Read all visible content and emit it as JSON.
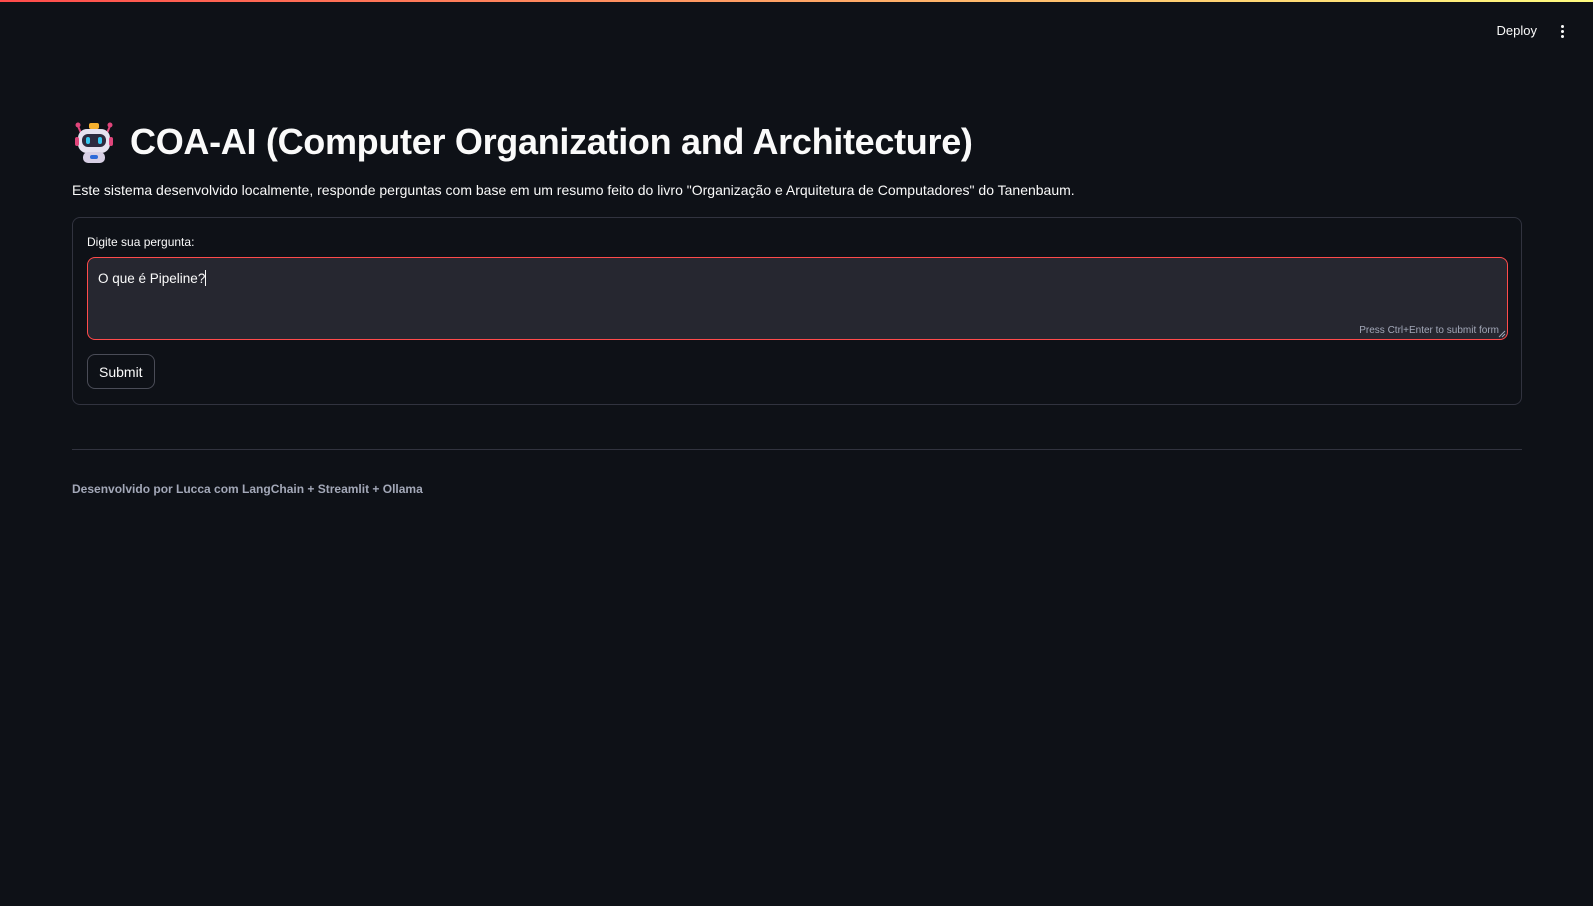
{
  "header": {
    "deploy_label": "Deploy",
    "menu_icon": "kebab-menu-icon"
  },
  "main": {
    "title_icon": "robot-icon",
    "title": "COA-AI (Computer Organization and Architecture)",
    "description": "Este sistema desenvolvido localmente, responde perguntas com base em um resumo feito do livro \"Organização e Arquitetura de Computadores\" do Tanenbaum."
  },
  "form": {
    "label": "Digite sua pergunta:",
    "value": "O que é Pipeline?",
    "hint": "Press Ctrl+Enter to submit form",
    "submit_label": "Submit"
  },
  "footer": {
    "text": "Desenvolvido por Lucca com LangChain + Streamlit + Ollama"
  },
  "colors": {
    "background": "#0e1117",
    "accent": "#ff4b4b",
    "input_background": "#262730",
    "muted_text": "#a3a8b8"
  }
}
